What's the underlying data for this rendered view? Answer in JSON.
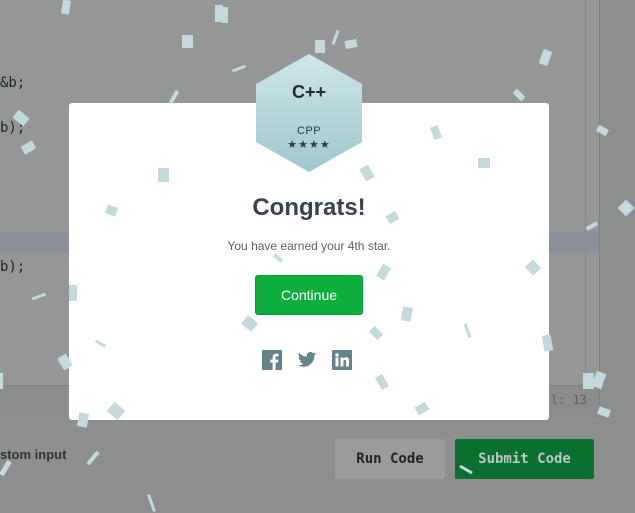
{
  "editor": {
    "lines": [
      {
        "text": "&b;"
      },
      {
        "text": "b);"
      },
      {
        "text": "b);"
      }
    ],
    "cursor_position": "l: 13"
  },
  "footer": {
    "custom_input_label": "stom input",
    "run_code_label": "Run Code",
    "submit_code_label": "Submit Code"
  },
  "modal": {
    "badge": {
      "logo_text": "C++",
      "language": "CPP",
      "stars": "★★★★",
      "star_count": 4
    },
    "title": "Congrats!",
    "message": "You have earned your 4th star.",
    "continue_label": "Continue",
    "share_icons": [
      "facebook-icon",
      "twitter-icon",
      "linkedin-icon"
    ]
  },
  "colors": {
    "continue": "#0dae3d",
    "submit": "#0a7030",
    "badge_top": "#c9e3e6",
    "badge_bottom": "#a3cbd1",
    "confetti": "#c3d9db",
    "share_icon": "#66828a"
  }
}
